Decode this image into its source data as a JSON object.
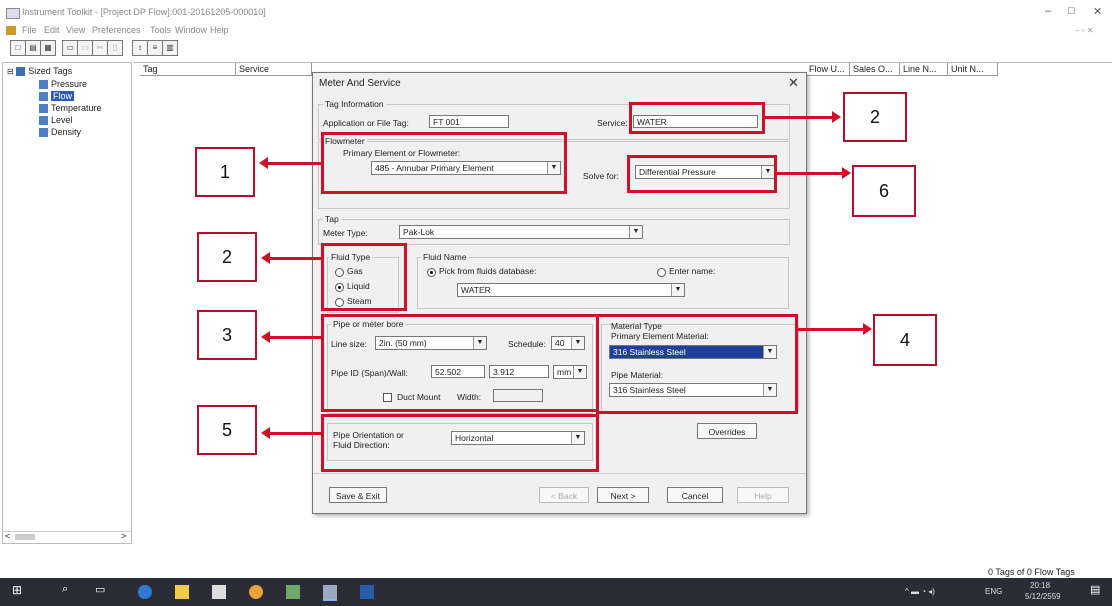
{
  "window": {
    "title": "Instrument Toolkit - [Project DP Flow]:001-20161205-000010]",
    "minimize": "–",
    "restore": "□",
    "close": "✕"
  },
  "menu": [
    "File",
    "Edit",
    "View",
    "Preferences",
    "Tools",
    "Window",
    "Help"
  ],
  "tree": {
    "root": "Sized Tags",
    "items": [
      "Pressure",
      "Flow",
      "Temperature",
      "Level",
      "Density"
    ],
    "selected": "Flow"
  },
  "grid": {
    "columns": [
      "Tag",
      "Service",
      "Flow U...",
      "Sales O...",
      "Line N...",
      "Unit N..."
    ]
  },
  "dialog": {
    "title": "Meter And Service",
    "close": "✕",
    "tag_info": {
      "group_label": "Tag Information",
      "app_tag_label": "Application or File Tag:",
      "app_tag_value": "FT 001",
      "service_label": "Service:",
      "service_value": "WATER"
    },
    "flowmeter": {
      "group_label": "Flowmeter",
      "primary_label": "Primary Element or Flowmeter:",
      "primary_value": "485 - Annubar Primary Element",
      "solve_for_label": "Solve for:",
      "solve_for_value": "Differential Pressure"
    },
    "tap": {
      "group_label": "Tap",
      "meter_type_label": "Meter Type:",
      "meter_type_value": "Pak-Lok"
    },
    "fluid_type": {
      "group_label": "Fluid Type",
      "options": [
        "Gas",
        "Liquid",
        "Steam"
      ],
      "selected": "Liquid"
    },
    "fluid_name": {
      "group_label": "Fluid Name",
      "pick_label": "Pick from fluids database:",
      "enter_label": "Enter name:",
      "value": "WATER"
    },
    "pipe": {
      "group_label": "Pipe or meter bore",
      "line_size_label": "Line size:",
      "line_size_value": "2in. (50 mm)",
      "schedule_label": "Schedule:",
      "schedule_value": "40",
      "pipe_id_label": "Pipe ID (Span)/Wall:",
      "pipe_id_value": "52.502",
      "wall_value": "3.912",
      "unit_value": "mm",
      "duct_mount_label": "Duct Mount",
      "width_label": "Width:"
    },
    "material": {
      "group_label": "Material Type",
      "primary_label": "Primary Element Material:",
      "primary_value": "316 Stainless Steel",
      "pipe_label": "Pipe Material:",
      "pipe_value": "316 Stainless Steel"
    },
    "orientation": {
      "label_line1": "Pipe Orientation or",
      "label_line2": "Fluid Direction:",
      "value": "Horizontal"
    },
    "buttons": {
      "overrides": "Overrides",
      "save_exit": "Save & Exit",
      "back": "< Back",
      "next": "Next >",
      "cancel": "Cancel",
      "help": "Help"
    }
  },
  "annotations": {
    "flowmeter": "1",
    "service": "2",
    "fluid_type": "2",
    "pipe": "3",
    "material": "4",
    "orientation": "5",
    "solve_for": "6"
  },
  "status": {
    "tags": "0 Tags of 0 Flow Tags"
  },
  "taskbar": {
    "language": "ENG",
    "time": "20:18",
    "date": "5/12/2559"
  },
  "colors": {
    "annotation_red": "#d0102b",
    "selection_blue": "#1e3f9c",
    "taskbar": "#2a2d36"
  }
}
